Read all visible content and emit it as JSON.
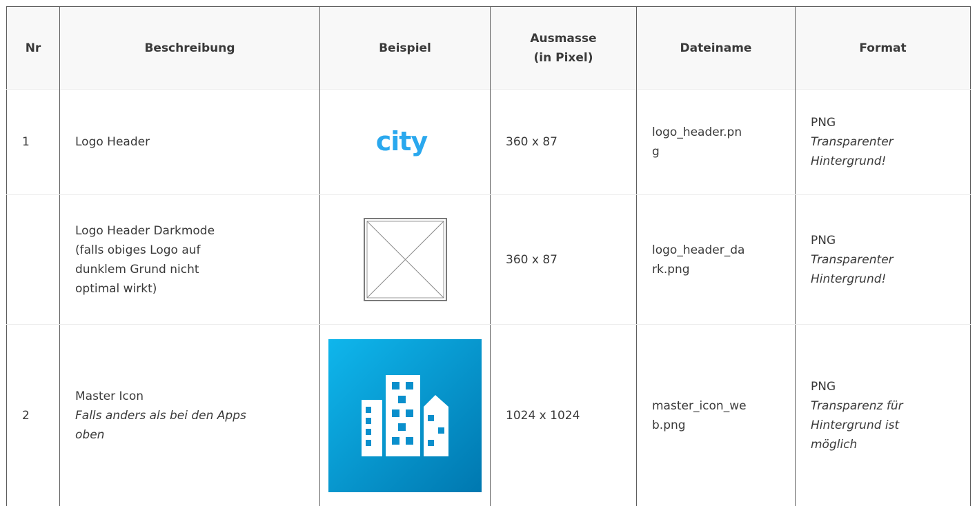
{
  "headers": {
    "nr": "Nr",
    "description": "Beschreibung",
    "example": "Beispiel",
    "dimensions_line1": "Ausmasse",
    "dimensions_line2": "(in Pixel)",
    "filename": "Dateiname",
    "format": "Format"
  },
  "rows": [
    {
      "nr": "1",
      "description": "Logo Header",
      "example_logo_text": "city",
      "dimensions": "360 x 87",
      "filename_line1": "logo_header.pn",
      "filename_line2": "g",
      "format": "PNG",
      "format_note_line1": "Transparenter",
      "format_note_line2": "Hintergrund!"
    },
    {
      "nr": "",
      "description_line1": "Logo Header Darkmode",
      "description_line2": "(falls obiges Logo auf",
      "description_line3": "dunklem Grund nicht",
      "description_line4": "optimal wirkt)",
      "example_icon": "image-placeholder-icon",
      "dimensions": "360 x 87",
      "filename_line1": "logo_header_da",
      "filename_line2": "rk.png",
      "format": "PNG",
      "format_note_line1": "Transparenter",
      "format_note_line2": "Hintergrund!"
    },
    {
      "nr": "2",
      "description": "Master Icon",
      "description_note_line1": "Falls anders als bei den Apps",
      "description_note_line2": "oben",
      "example_icon": "city-buildings-icon",
      "dimensions": "1024 x 1024",
      "filename_line1": "master_icon_we",
      "filename_line2": "b.png",
      "format": "PNG",
      "format_note_line1": "Transparenz für",
      "format_note_line2": "Hintergrund ist",
      "format_note_line3": "möglich"
    }
  ],
  "colors": {
    "logo_blue": "#2aa8ee",
    "icon_gradient_start": "#0fb6ec",
    "icon_gradient_end": "#0078b0",
    "text": "#3a3a3a",
    "border": "#5e5e5e"
  }
}
